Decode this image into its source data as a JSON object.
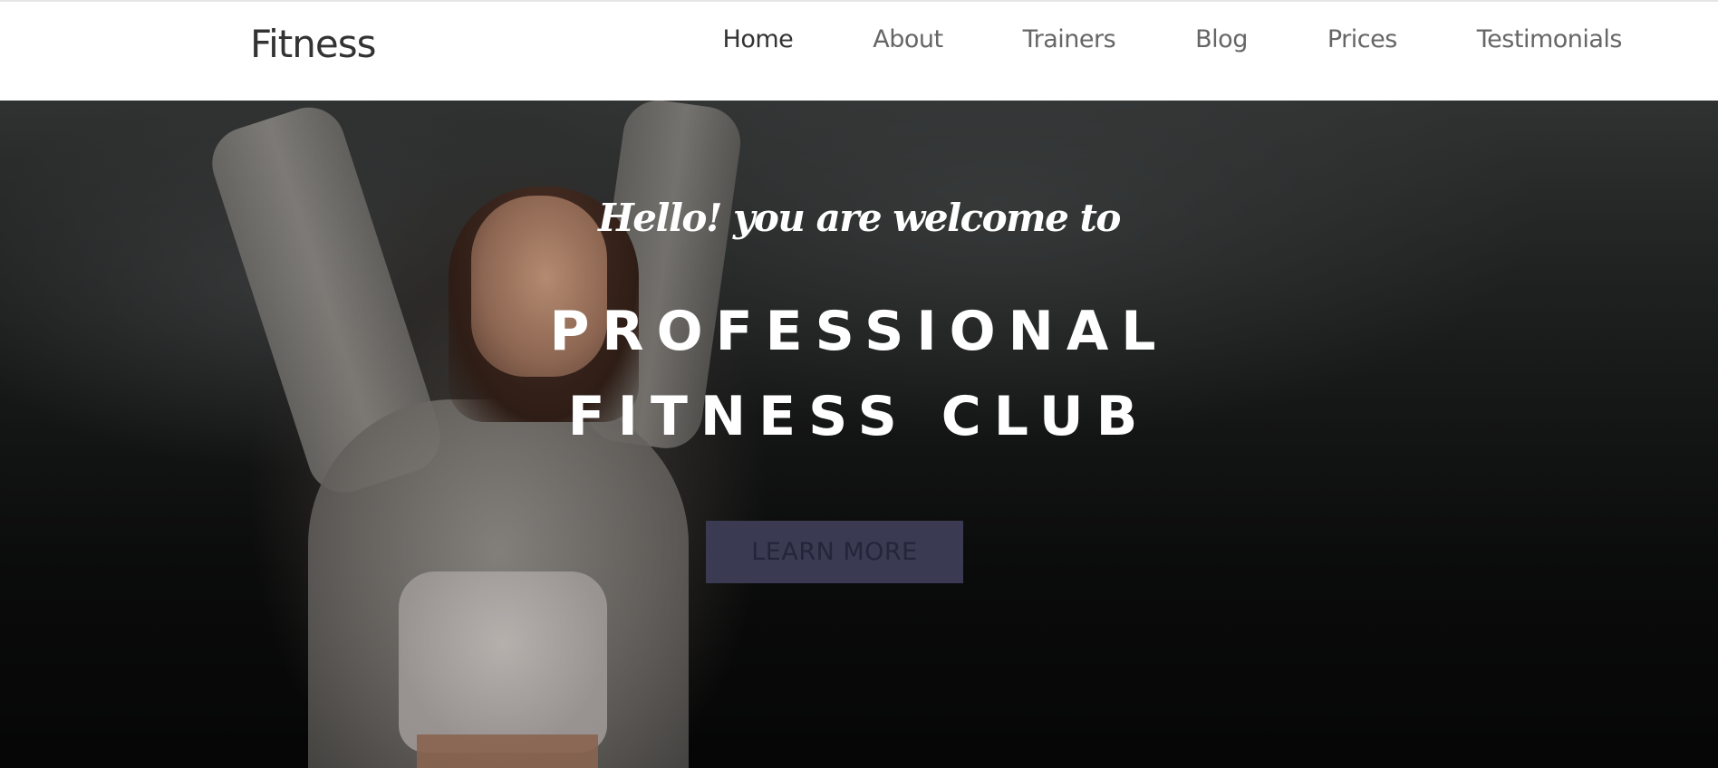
{
  "navbar": {
    "brand": "Fitness",
    "links": [
      {
        "label": "Home",
        "active": true
      },
      {
        "label": "About",
        "active": false
      },
      {
        "label": "Trainers",
        "active": false
      },
      {
        "label": "Blog",
        "active": false
      },
      {
        "label": "Prices",
        "active": false
      },
      {
        "label": "Testimonials",
        "active": false
      }
    ]
  },
  "hero": {
    "greeting": "Hello! you are welcome to",
    "title_line_1": "PROFESSIONAL",
    "title_line_2": "FITNESS CLUB",
    "cta_label": "LEARN MORE"
  },
  "colors": {
    "nav_background": "#ffffff",
    "nav_text": "#666666",
    "nav_active_text": "#333333",
    "hero_text": "#ffffff",
    "cta_background": "#3a3a52"
  }
}
